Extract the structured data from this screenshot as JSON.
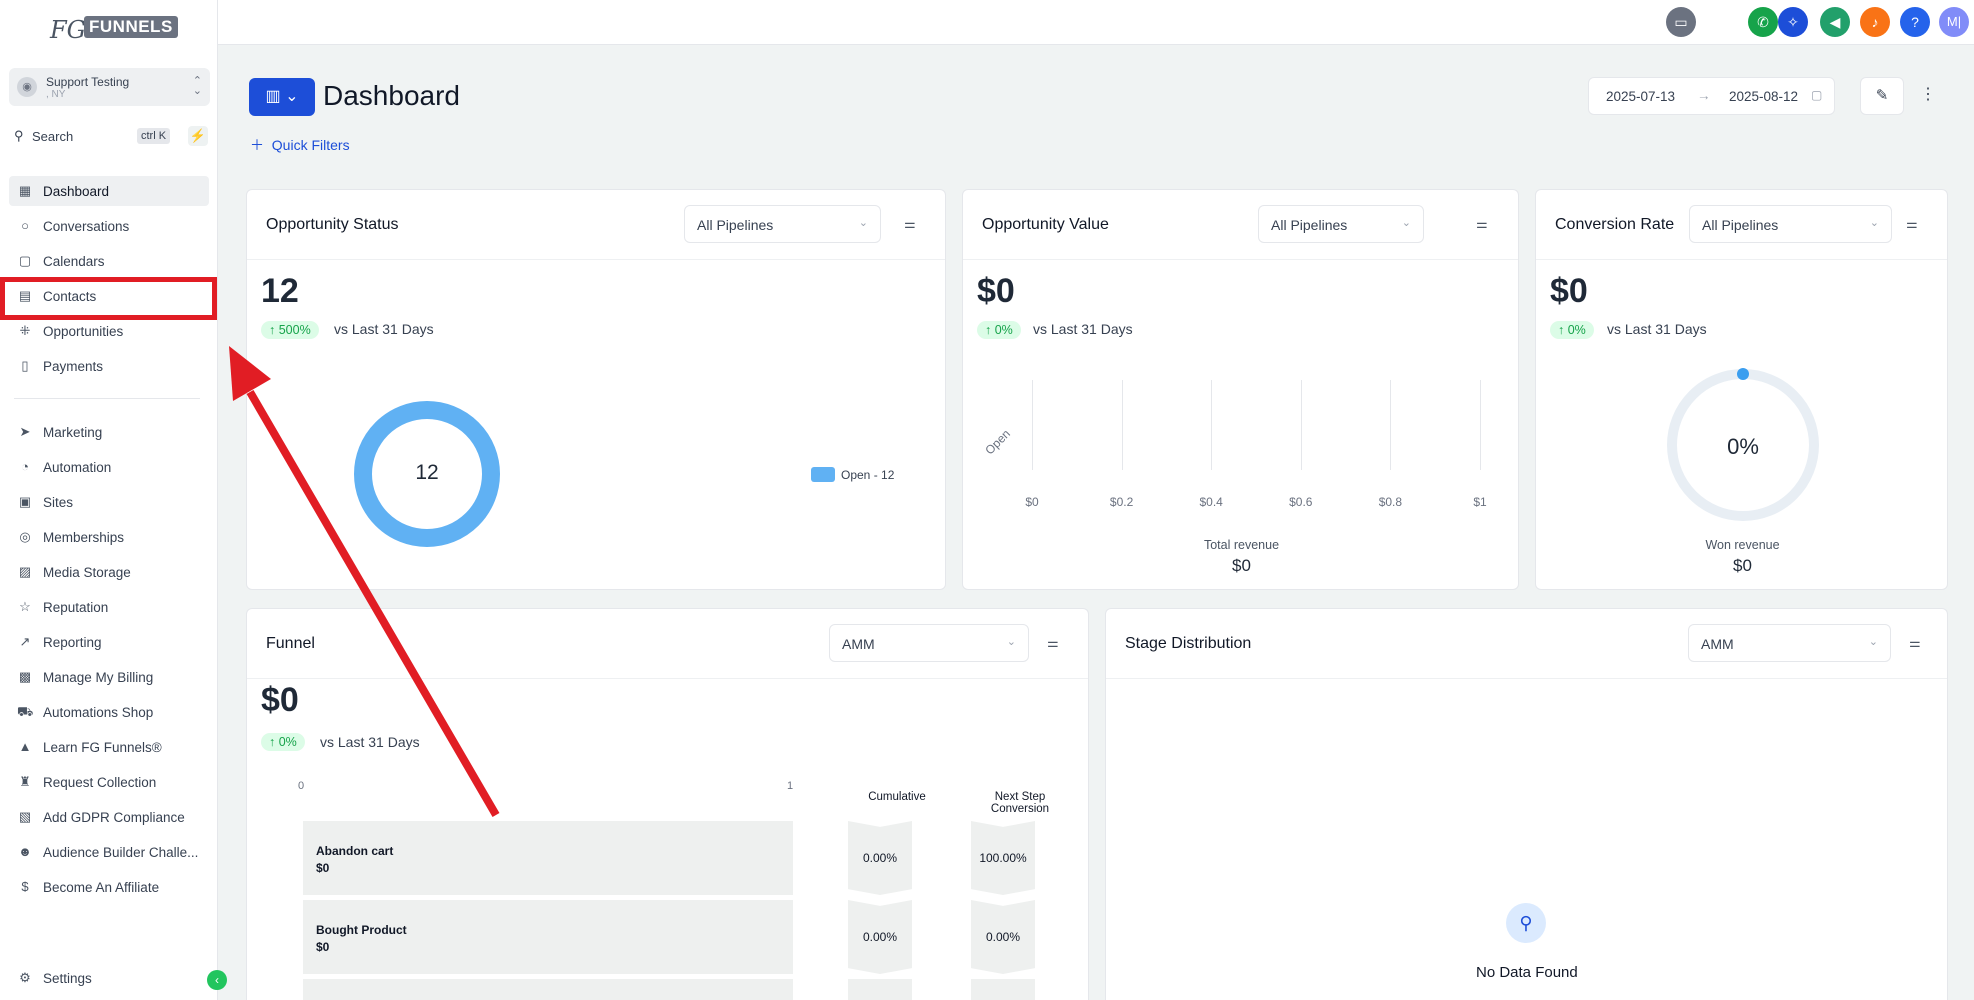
{
  "brand": {
    "fg": "FG",
    "funnels": "FUNNELS"
  },
  "account": {
    "name": "Support Testing",
    "location": ", NY"
  },
  "search": {
    "label": "Search",
    "shortcut": "ctrl K"
  },
  "nav": [
    {
      "label": "Dashboard",
      "icon": "grid-icon",
      "glyph": "▦"
    },
    {
      "label": "Conversations",
      "icon": "chat-icon",
      "glyph": "○"
    },
    {
      "label": "Calendars",
      "icon": "calendar-icon",
      "glyph": "▢"
    },
    {
      "label": "Contacts",
      "icon": "contacts-icon",
      "glyph": "▤"
    },
    {
      "label": "Opportunities",
      "icon": "opportunities-icon",
      "glyph": "⁜"
    },
    {
      "label": "Payments",
      "icon": "payments-icon",
      "glyph": "▯"
    },
    {
      "label": "Marketing",
      "icon": "send-icon",
      "glyph": "➤"
    },
    {
      "label": "Automation",
      "icon": "automation-icon",
      "glyph": "◔"
    },
    {
      "label": "Sites",
      "icon": "sites-icon",
      "glyph": "▣"
    },
    {
      "label": "Memberships",
      "icon": "memberships-icon",
      "glyph": "◎"
    },
    {
      "label": "Media Storage",
      "icon": "image-icon",
      "glyph": "▨"
    },
    {
      "label": "Reputation",
      "icon": "star-icon",
      "glyph": "☆"
    },
    {
      "label": "Reporting",
      "icon": "trend-icon",
      "glyph": "↗"
    },
    {
      "label": "Manage My Billing",
      "icon": "billing-icon",
      "glyph": "▩"
    },
    {
      "label": "Automations Shop",
      "icon": "cart-icon",
      "glyph": "⛟"
    },
    {
      "label": "Learn FG Funnels®",
      "icon": "graduation-icon",
      "glyph": "▲"
    },
    {
      "label": "Request Collection",
      "icon": "trophy-icon",
      "glyph": "♜"
    },
    {
      "label": "Add GDPR Compliance",
      "icon": "document-icon",
      "glyph": "▧"
    },
    {
      "label": "Audience Builder Challe...",
      "icon": "users-icon",
      "glyph": "☻"
    },
    {
      "label": "Become An Affiliate",
      "icon": "dollar-icon",
      "glyph": "$"
    }
  ],
  "settings": {
    "label": "Settings"
  },
  "page": {
    "title": "Dashboard",
    "quick_filters": "Quick Filters",
    "date_from": "2025-07-13",
    "date_to": "2025-08-12"
  },
  "opp_status": {
    "title": "Opportunity Status",
    "filter": "All Pipelines",
    "value": "12",
    "change": "↑ 500%",
    "vs": "vs Last 31 Days",
    "donut_label": "12",
    "legend": "Open - 12"
  },
  "opp_value": {
    "title": "Opportunity Value",
    "filter": "All Pipelines",
    "value": "$0",
    "change": "↑ 0%",
    "vs": "vs Last 31 Days",
    "category": "Open",
    "ticks": [
      "$0",
      "$0.2",
      "$0.4",
      "$0.6",
      "$0.8",
      "$1"
    ],
    "footer_label": "Total revenue",
    "footer_value": "$0"
  },
  "conv_rate": {
    "title": "Conversion Rate",
    "filter": "All Pipelines",
    "value": "$0",
    "change": "↑ 0%",
    "vs": "vs Last 31 Days",
    "gauge_label": "0%",
    "footer_label": "Won revenue",
    "footer_value": "$0"
  },
  "funnel": {
    "title": "Funnel",
    "filter": "AMM",
    "value": "$0",
    "change": "↑ 0%",
    "vs": "vs Last 31 Days",
    "axis_min": "0",
    "axis_max": "1",
    "col_cumulative": "Cumulative",
    "col_next_1": "Next Step",
    "col_next_2": "Conversion",
    "rows": [
      {
        "name": "Abandon cart",
        "value": "$0",
        "cumulative": "0.00%",
        "next": "100.00%"
      },
      {
        "name": "Bought Product",
        "value": "$0",
        "cumulative": "0.00%",
        "next": "0.00%"
      }
    ]
  },
  "stage": {
    "title": "Stage Distribution",
    "filter": "AMM",
    "empty": "No Data Found"
  },
  "topbar": {
    "user_initials": "M|",
    "help": "?"
  },
  "colors": {
    "accent": "#1d4ed8",
    "annotation": "#e11d24",
    "donut": "#60b1f3",
    "positive": "#16a34a"
  }
}
